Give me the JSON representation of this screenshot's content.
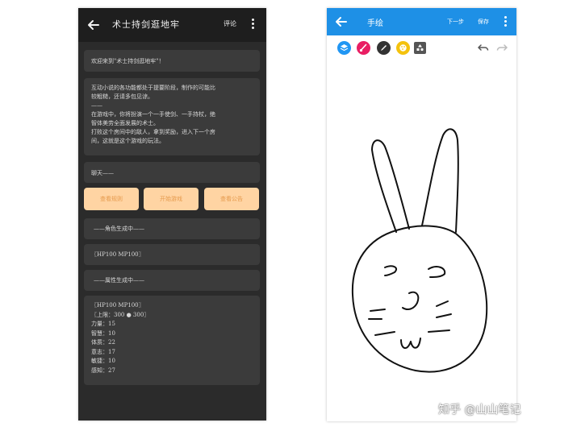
{
  "left_app": {
    "title": "术士持剑逛地牢",
    "comment_label": "评论",
    "welcome": "欢迎来到\"术士持剑逛地牢\"！",
    "intro_lines": [
      "互动小说的各功能都处于提要阶段，制作的可能比",
      "较粗糙，还请多包见谅。",
      "——",
      "在游戏中，你将扮演一个一手使剑、一手持杖，绝",
      "智体美劳全面发展的术士。",
      "打败这个房间中的敌人，拿到奖励，进入下一个房",
      "间，这就是这个游戏的玩法。"
    ],
    "chat_hint": "聊天——",
    "buttons": [
      "查看规则",
      "开始游戏",
      "查看公告"
    ],
    "role_generating": "——角色生成中——",
    "hp_mp": "〖HP100 MP100〗",
    "attr_generating": "——属性生成中——",
    "stats": {
      "hp_mp": "〖HP100 MP100〗",
      "limit": "〖上限：300 ● 300〗",
      "strength": "力量：15",
      "intelligence": "智慧：10",
      "constitution": "体质：22",
      "will": "意志：17",
      "agility": "敏捷：10",
      "perception": "感知：27"
    }
  },
  "right_app": {
    "title": "手绘",
    "next_label": "下一步",
    "save_label": "保存",
    "tools": [
      "layers-icon",
      "brush-icon",
      "pen-icon",
      "palette-icon",
      "shapes-icon"
    ],
    "accent_color": "#1e90e6",
    "drawing": "hand-drawn rabbit face"
  },
  "watermark": "知乎 @山山笔记"
}
